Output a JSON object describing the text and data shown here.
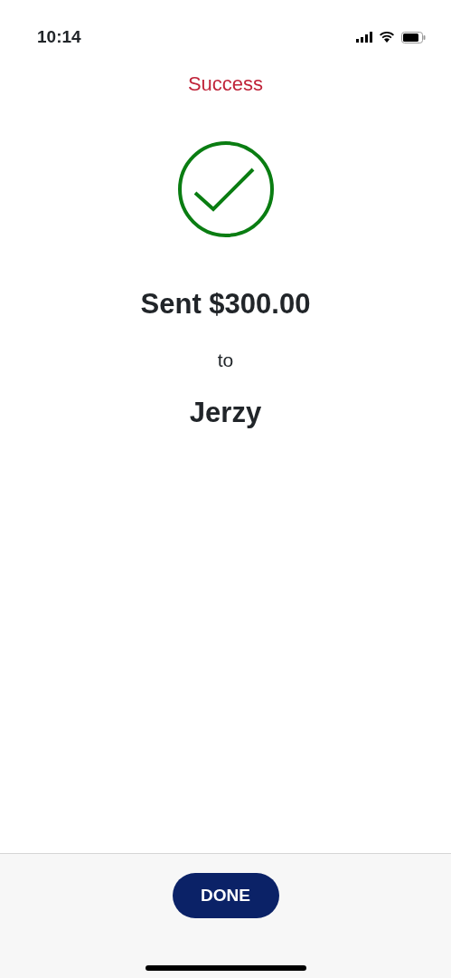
{
  "status_bar": {
    "time": "10:14"
  },
  "header": {
    "title": "Success"
  },
  "confirmation": {
    "amount_line": "Sent $300.00",
    "connector": "to",
    "recipient": "Jerzy"
  },
  "footer": {
    "button": "DONE"
  }
}
